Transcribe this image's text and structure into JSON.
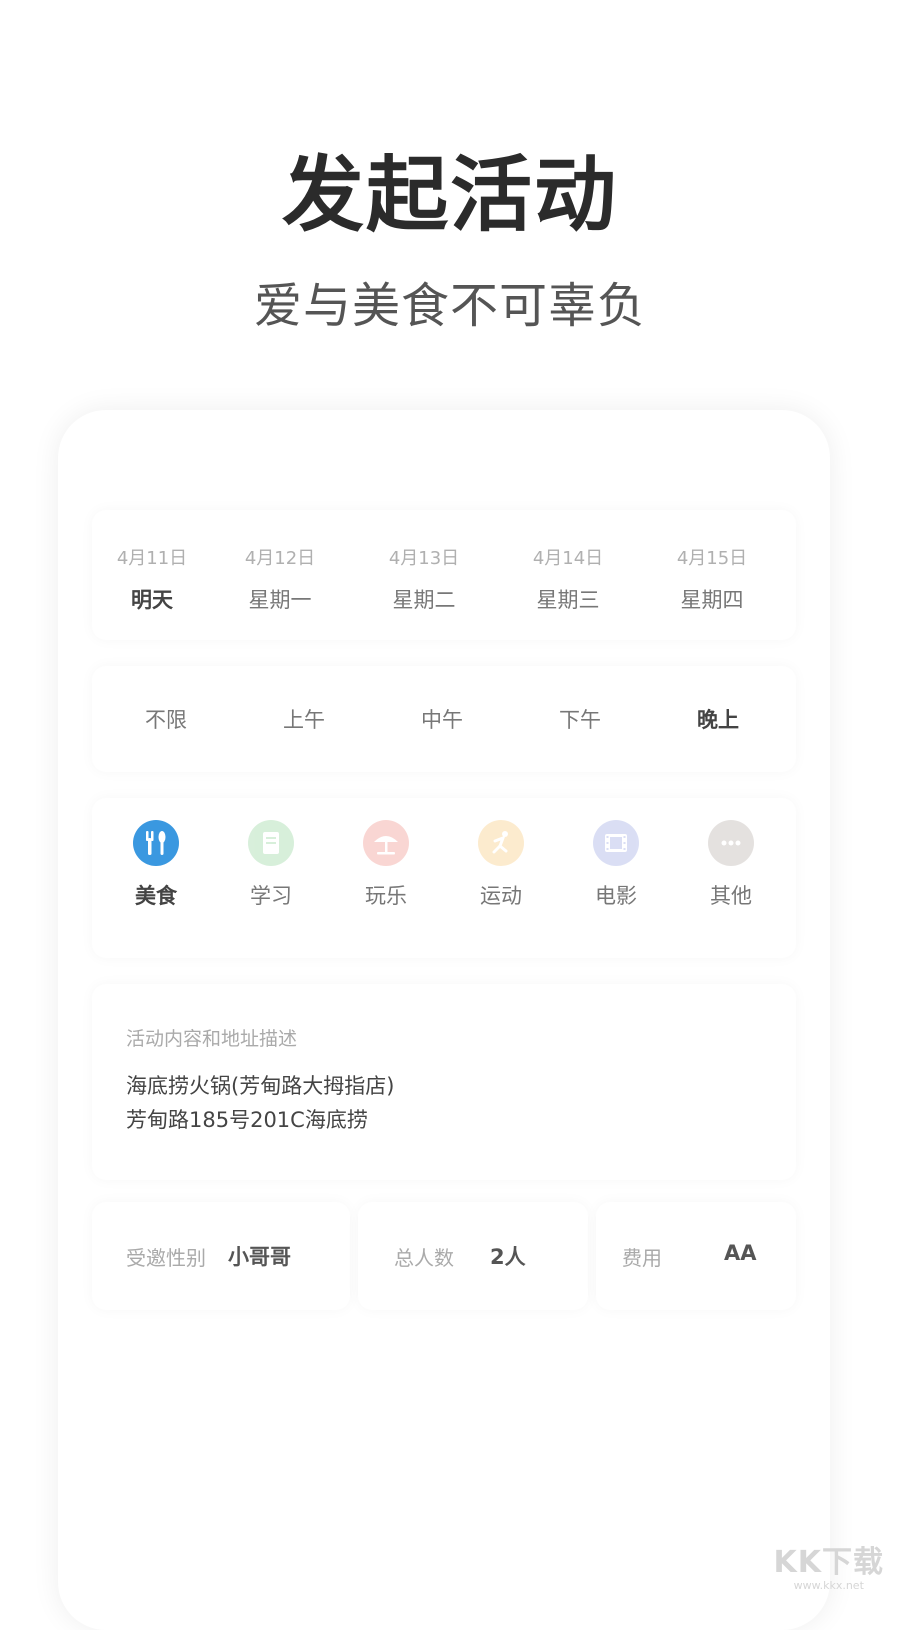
{
  "hero": {
    "title": "发起活动",
    "subtitle": "爱与美食不可辜负"
  },
  "dates": [
    {
      "date": "4月11日",
      "day": "明天",
      "selected": true
    },
    {
      "date": "4月12日",
      "day": "星期一",
      "selected": false
    },
    {
      "date": "4月13日",
      "day": "星期二",
      "selected": false
    },
    {
      "date": "4月14日",
      "day": "星期三",
      "selected": false
    },
    {
      "date": "4月15日",
      "day": "星期四",
      "selected": false
    }
  ],
  "times": [
    {
      "label": "不限",
      "selected": false
    },
    {
      "label": "上午",
      "selected": false
    },
    {
      "label": "中午",
      "selected": false
    },
    {
      "label": "下午",
      "selected": false
    },
    {
      "label": "晚上",
      "selected": true
    }
  ],
  "categories": [
    {
      "label": "美食",
      "icon": "utensils-icon",
      "color": "#3a98e0",
      "selected": true
    },
    {
      "label": "学习",
      "icon": "book-icon",
      "color": "#4cb85c",
      "selected": false
    },
    {
      "label": "玩乐",
      "icon": "umbrella-icon",
      "color": "#e64a3b",
      "selected": false
    },
    {
      "label": "运动",
      "icon": "runner-icon",
      "color": "#f5a623",
      "selected": false
    },
    {
      "label": "电影",
      "icon": "film-icon",
      "color": "#5a6fd1",
      "selected": false
    },
    {
      "label": "其他",
      "icon": "more-icon",
      "color": "#8a7a72",
      "selected": false
    }
  ],
  "description": {
    "placeholder": "活动内容和地址描述",
    "line1": "海底捞火锅(芳甸路大拇指店)",
    "line2": "芳甸路185号201C海底捞"
  },
  "info": {
    "gender_label": "受邀性别",
    "gender_value": "小哥哥",
    "people_label": "总人数",
    "people_value": "2人",
    "fee_label": "费用",
    "fee_value": "AA"
  },
  "watermark": {
    "logo": "KK下载",
    "url": "www.kkx.net"
  }
}
